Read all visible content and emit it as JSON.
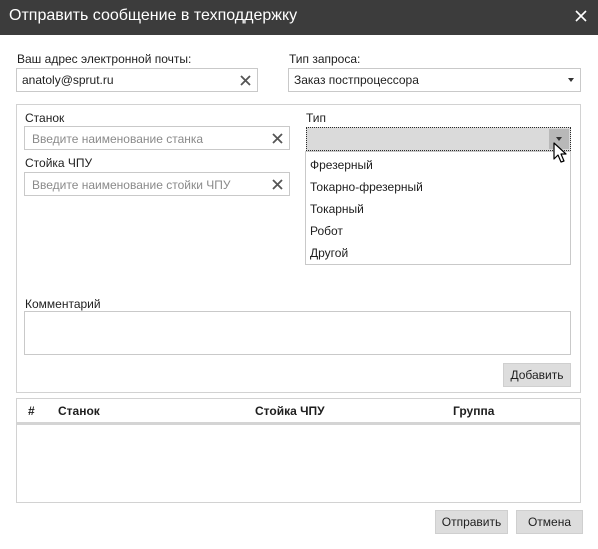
{
  "window": {
    "title": "Отправить сообщение в техподдержку"
  },
  "form": {
    "email_label": "Ваш адрес электронной почты:",
    "email_value": "anatoly@sprut.ru",
    "request_type_label": "Тип запроса:",
    "request_type_value": "Заказ постпроцессора"
  },
  "machine": {
    "machine_label": "Станок",
    "machine_placeholder": "Введите наименование станка",
    "cnc_label": "Стойка ЧПУ",
    "cnc_placeholder": "Введите наименование стойки ЧПУ",
    "type_label": "Тип",
    "type_value": "",
    "type_options": [
      "Фрезерный",
      "Токарно-фрезерный",
      "Токарный",
      "Робот",
      "Другой"
    ],
    "comment_label": "Комментарий",
    "comment_value": "",
    "add_label": "Добавить"
  },
  "table": {
    "columns": [
      "#",
      "Станок",
      "Стойка ЧПУ",
      "Группа"
    ],
    "rows": []
  },
  "footer": {
    "send_label": "Отправить",
    "cancel_label": "Отмена"
  },
  "icons": {
    "close": "close-icon",
    "clear": "clear-x-icon",
    "dropdown": "chevron-down-icon",
    "cursor": "mouse-pointer-icon"
  }
}
